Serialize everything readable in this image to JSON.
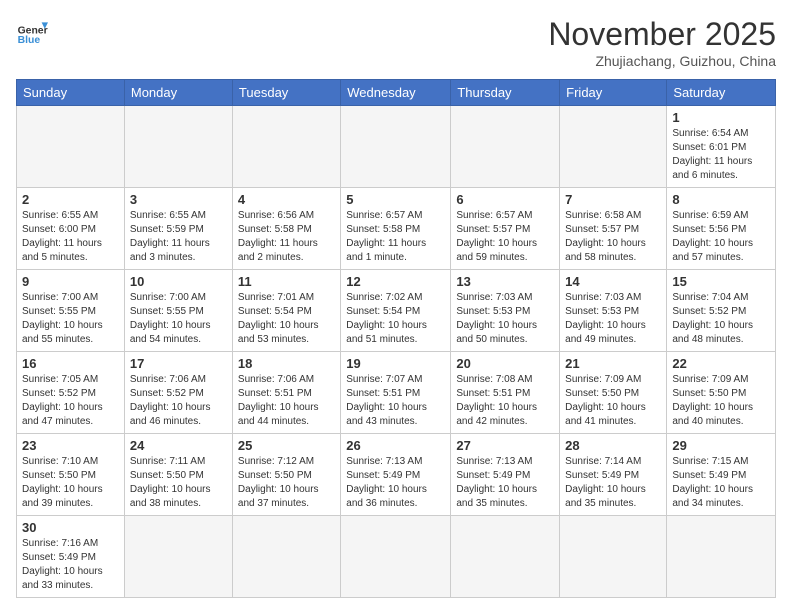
{
  "logo": {
    "general": "General",
    "blue": "Blue"
  },
  "title": "November 2025",
  "location": "Zhujiachang, Guizhou, China",
  "weekdays": [
    "Sunday",
    "Monday",
    "Tuesday",
    "Wednesday",
    "Thursday",
    "Friday",
    "Saturday"
  ],
  "weeks": [
    [
      {
        "day": "",
        "info": ""
      },
      {
        "day": "",
        "info": ""
      },
      {
        "day": "",
        "info": ""
      },
      {
        "day": "",
        "info": ""
      },
      {
        "day": "",
        "info": ""
      },
      {
        "day": "",
        "info": ""
      },
      {
        "day": "1",
        "info": "Sunrise: 6:54 AM\nSunset: 6:01 PM\nDaylight: 11 hours and 6 minutes."
      }
    ],
    [
      {
        "day": "2",
        "info": "Sunrise: 6:55 AM\nSunset: 6:00 PM\nDaylight: 11 hours and 5 minutes."
      },
      {
        "day": "3",
        "info": "Sunrise: 6:55 AM\nSunset: 5:59 PM\nDaylight: 11 hours and 3 minutes."
      },
      {
        "day": "4",
        "info": "Sunrise: 6:56 AM\nSunset: 5:58 PM\nDaylight: 11 hours and 2 minutes."
      },
      {
        "day": "5",
        "info": "Sunrise: 6:57 AM\nSunset: 5:58 PM\nDaylight: 11 hours and 1 minute."
      },
      {
        "day": "6",
        "info": "Sunrise: 6:57 AM\nSunset: 5:57 PM\nDaylight: 10 hours and 59 minutes."
      },
      {
        "day": "7",
        "info": "Sunrise: 6:58 AM\nSunset: 5:57 PM\nDaylight: 10 hours and 58 minutes."
      },
      {
        "day": "8",
        "info": "Sunrise: 6:59 AM\nSunset: 5:56 PM\nDaylight: 10 hours and 57 minutes."
      }
    ],
    [
      {
        "day": "9",
        "info": "Sunrise: 7:00 AM\nSunset: 5:55 PM\nDaylight: 10 hours and 55 minutes."
      },
      {
        "day": "10",
        "info": "Sunrise: 7:00 AM\nSunset: 5:55 PM\nDaylight: 10 hours and 54 minutes."
      },
      {
        "day": "11",
        "info": "Sunrise: 7:01 AM\nSunset: 5:54 PM\nDaylight: 10 hours and 53 minutes."
      },
      {
        "day": "12",
        "info": "Sunrise: 7:02 AM\nSunset: 5:54 PM\nDaylight: 10 hours and 51 minutes."
      },
      {
        "day": "13",
        "info": "Sunrise: 7:03 AM\nSunset: 5:53 PM\nDaylight: 10 hours and 50 minutes."
      },
      {
        "day": "14",
        "info": "Sunrise: 7:03 AM\nSunset: 5:53 PM\nDaylight: 10 hours and 49 minutes."
      },
      {
        "day": "15",
        "info": "Sunrise: 7:04 AM\nSunset: 5:52 PM\nDaylight: 10 hours and 48 minutes."
      }
    ],
    [
      {
        "day": "16",
        "info": "Sunrise: 7:05 AM\nSunset: 5:52 PM\nDaylight: 10 hours and 47 minutes."
      },
      {
        "day": "17",
        "info": "Sunrise: 7:06 AM\nSunset: 5:52 PM\nDaylight: 10 hours and 46 minutes."
      },
      {
        "day": "18",
        "info": "Sunrise: 7:06 AM\nSunset: 5:51 PM\nDaylight: 10 hours and 44 minutes."
      },
      {
        "day": "19",
        "info": "Sunrise: 7:07 AM\nSunset: 5:51 PM\nDaylight: 10 hours and 43 minutes."
      },
      {
        "day": "20",
        "info": "Sunrise: 7:08 AM\nSunset: 5:51 PM\nDaylight: 10 hours and 42 minutes."
      },
      {
        "day": "21",
        "info": "Sunrise: 7:09 AM\nSunset: 5:50 PM\nDaylight: 10 hours and 41 minutes."
      },
      {
        "day": "22",
        "info": "Sunrise: 7:09 AM\nSunset: 5:50 PM\nDaylight: 10 hours and 40 minutes."
      }
    ],
    [
      {
        "day": "23",
        "info": "Sunrise: 7:10 AM\nSunset: 5:50 PM\nDaylight: 10 hours and 39 minutes."
      },
      {
        "day": "24",
        "info": "Sunrise: 7:11 AM\nSunset: 5:50 PM\nDaylight: 10 hours and 38 minutes."
      },
      {
        "day": "25",
        "info": "Sunrise: 7:12 AM\nSunset: 5:50 PM\nDaylight: 10 hours and 37 minutes."
      },
      {
        "day": "26",
        "info": "Sunrise: 7:13 AM\nSunset: 5:49 PM\nDaylight: 10 hours and 36 minutes."
      },
      {
        "day": "27",
        "info": "Sunrise: 7:13 AM\nSunset: 5:49 PM\nDaylight: 10 hours and 35 minutes."
      },
      {
        "day": "28",
        "info": "Sunrise: 7:14 AM\nSunset: 5:49 PM\nDaylight: 10 hours and 35 minutes."
      },
      {
        "day": "29",
        "info": "Sunrise: 7:15 AM\nSunset: 5:49 PM\nDaylight: 10 hours and 34 minutes."
      }
    ],
    [
      {
        "day": "30",
        "info": "Sunrise: 7:16 AM\nSunset: 5:49 PM\nDaylight: 10 hours and 33 minutes."
      },
      {
        "day": "",
        "info": ""
      },
      {
        "day": "",
        "info": ""
      },
      {
        "day": "",
        "info": ""
      },
      {
        "day": "",
        "info": ""
      },
      {
        "day": "",
        "info": ""
      },
      {
        "day": "",
        "info": ""
      }
    ]
  ]
}
